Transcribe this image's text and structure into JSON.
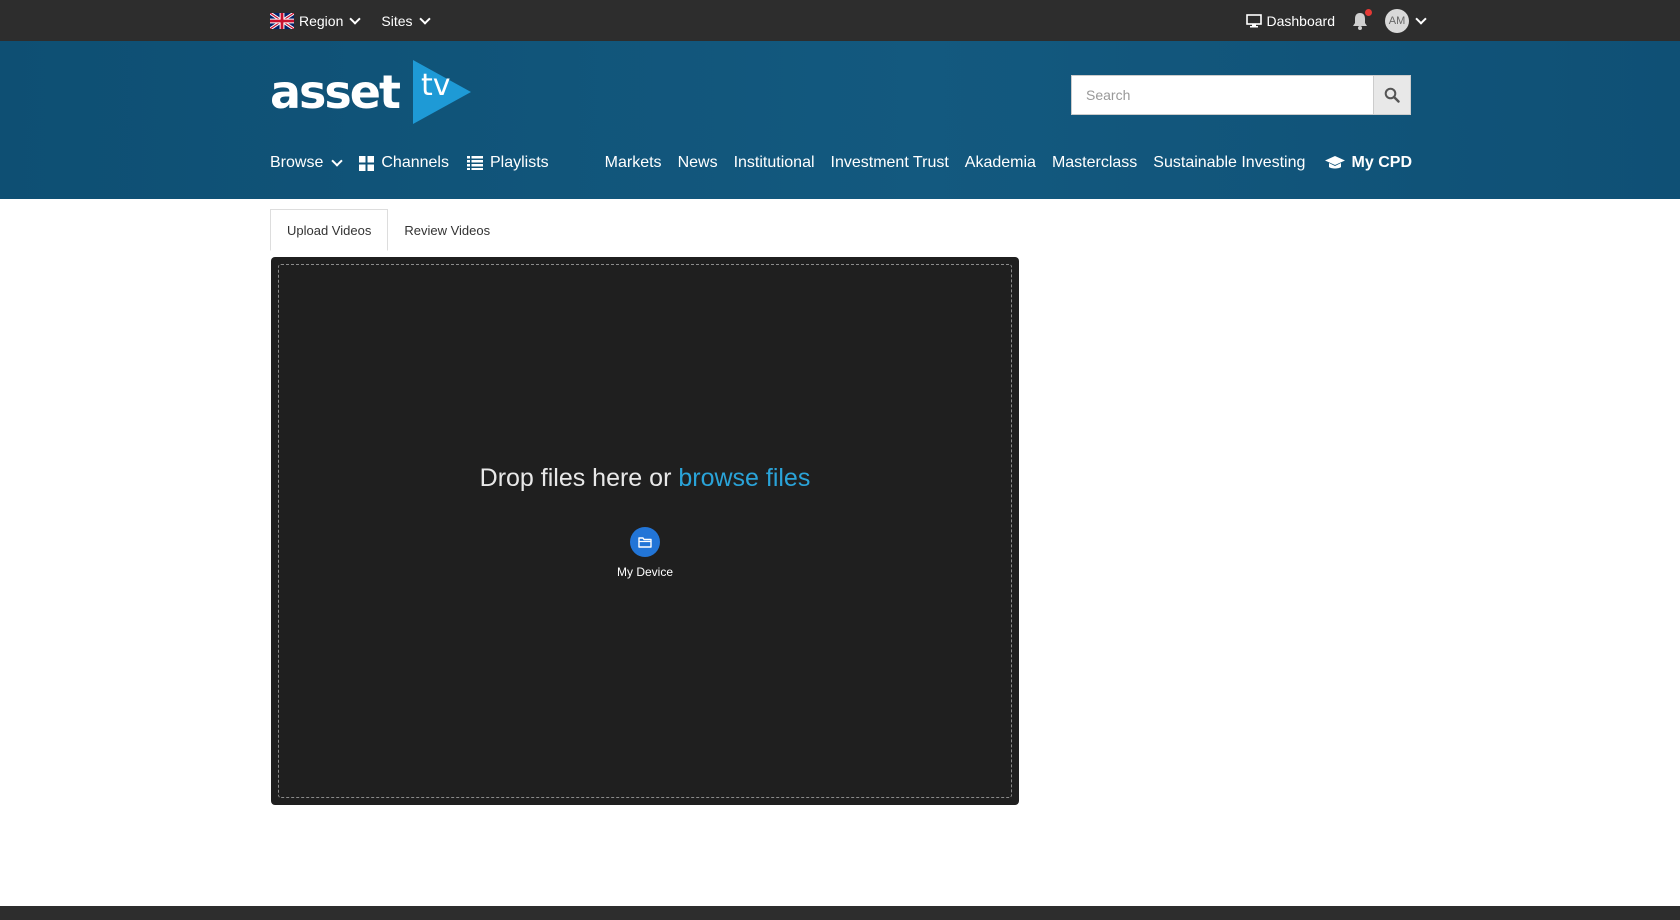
{
  "topbar": {
    "region_label": "Region",
    "sites_label": "Sites",
    "dashboard_label": "Dashboard",
    "avatar_initials": "AM",
    "notification_dot_color": "#e53935"
  },
  "header": {
    "logo_text": "asset",
    "logo_tv": "tv",
    "logo_accent_color": "#1e9ad6",
    "search": {
      "placeholder": "Search",
      "value": ""
    }
  },
  "nav": {
    "browse_label": "Browse",
    "channels_label": "Channels",
    "playlists_label": "Playlists",
    "links": [
      "Markets",
      "News",
      "Institutional",
      "Investment Trust",
      "Akademia",
      "Masterclass",
      "Sustainable Investing"
    ],
    "mycpd_label": "My CPD"
  },
  "tabs": [
    {
      "label": "Upload Videos",
      "active": true
    },
    {
      "label": "Review Videos",
      "active": false
    }
  ],
  "uploader": {
    "drop_text": "Drop files here or",
    "browse_text": "browse files",
    "source_label": "My Device",
    "source_icon": "folder-icon",
    "link_color": "#2aa3d8"
  }
}
